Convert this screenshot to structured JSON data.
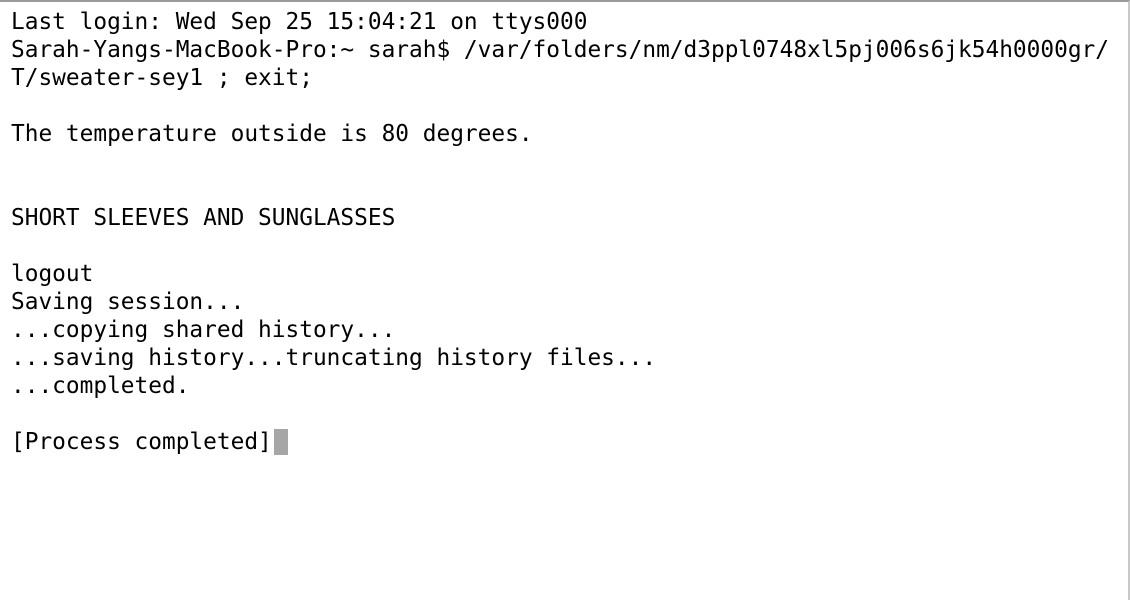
{
  "terminal": {
    "lines": [
      "Last login: Wed Sep 25 15:04:21 on ttys000",
      "Sarah-Yangs-MacBook-Pro:~ sarah$ /var/folders/nm/d3ppl0748xl5pj006s6jk54h0000gr/",
      "T/sweater-sey1 ; exit;",
      "",
      "The temperature outside is 80 degrees.",
      "",
      "",
      "SHORT SLEEVES AND SUNGLASSES",
      "",
      "logout",
      "Saving session...",
      "...copying shared history...",
      "...saving history...truncating history files...",
      "...completed.",
      "",
      "[Process completed]"
    ],
    "cursor_color": "#a6a6a6"
  }
}
